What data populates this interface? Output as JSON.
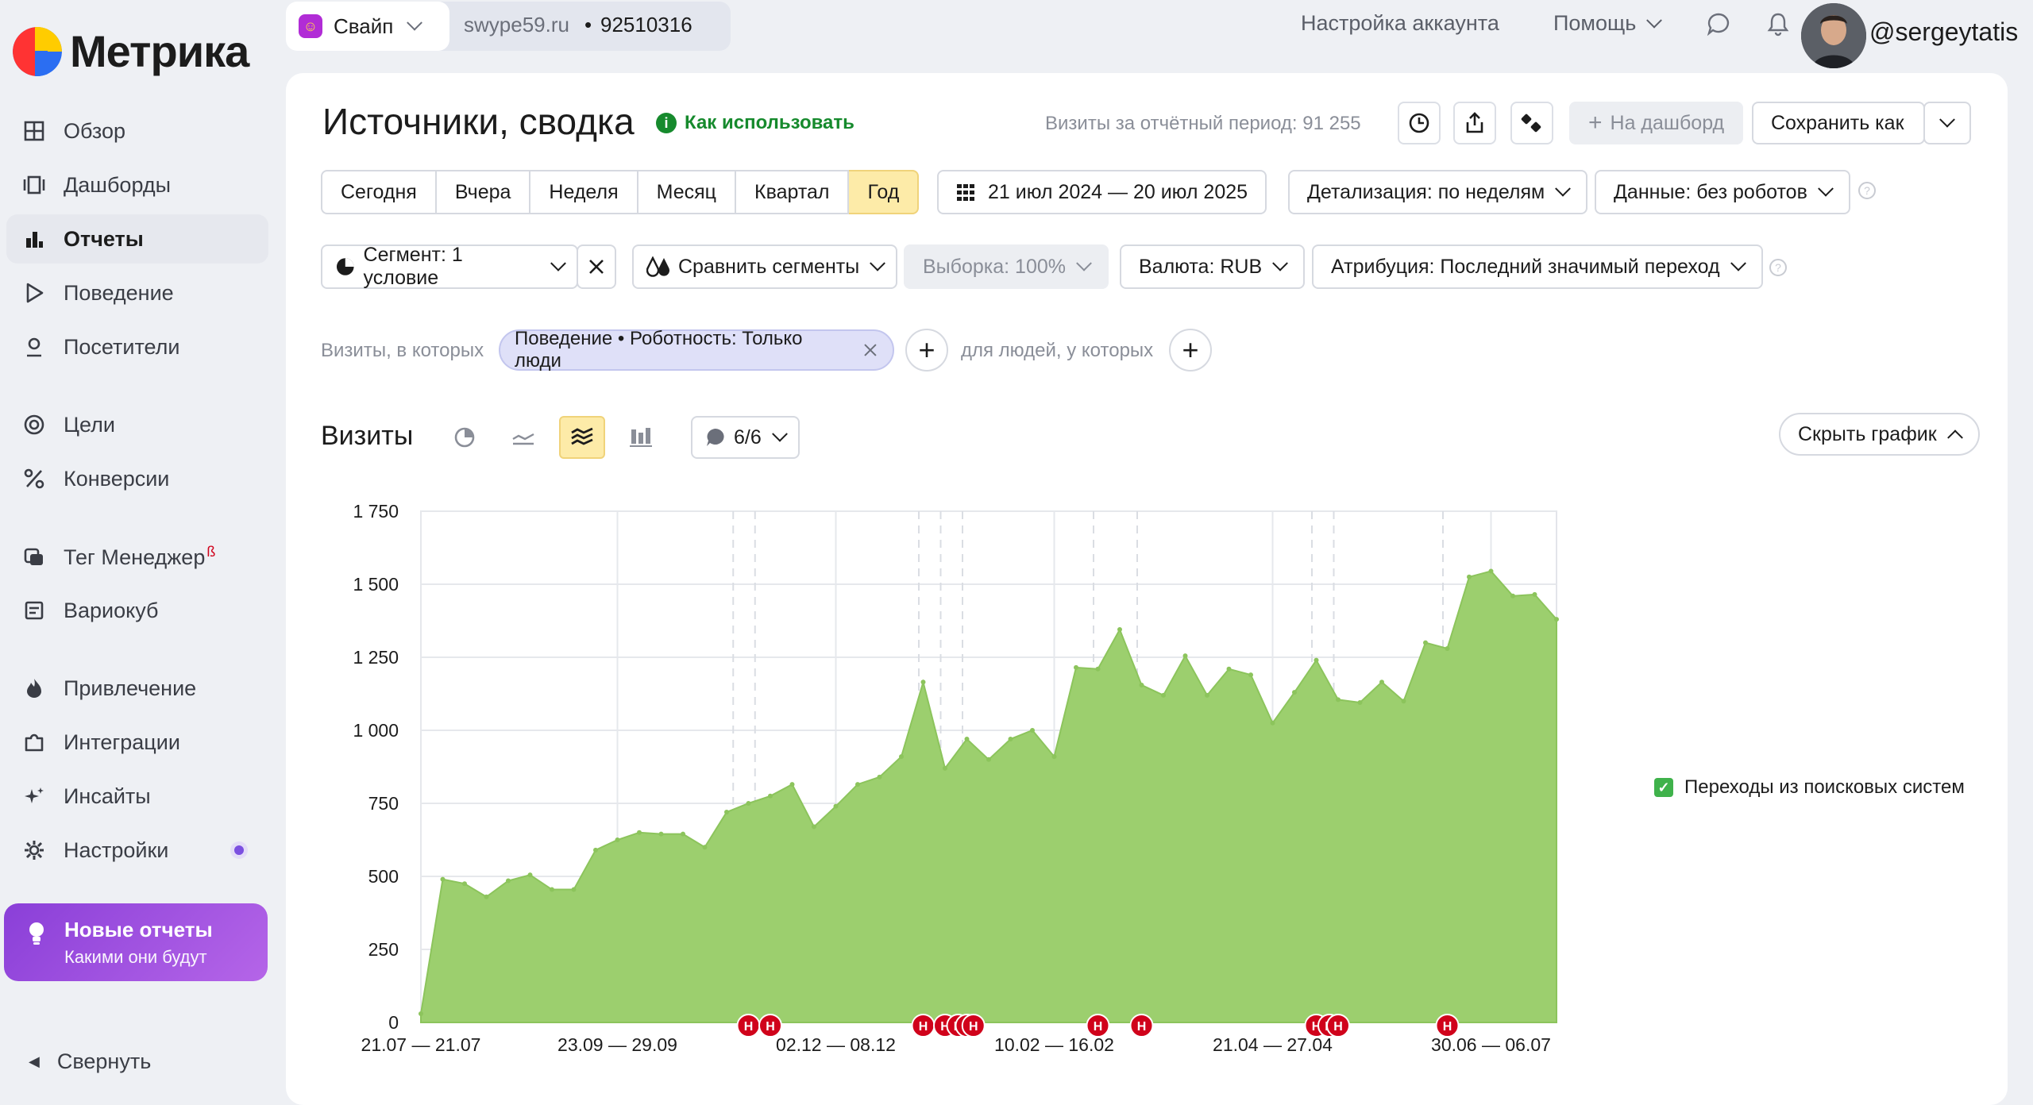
{
  "app": {
    "logo_text": "Метрика"
  },
  "sidebar": {
    "items": [
      {
        "label": "Обзор",
        "icon": "grid-icon"
      },
      {
        "label": "Дашборды",
        "icon": "dashboards-icon"
      },
      {
        "label": "Отчеты",
        "icon": "bar-chart-icon"
      },
      {
        "label": "Поведение",
        "icon": "play-icon"
      },
      {
        "label": "Посетители",
        "icon": "person-icon"
      },
      {
        "label": "Цели",
        "icon": "target-icon"
      },
      {
        "label": "Конверсии",
        "icon": "percent-icon"
      },
      {
        "label": "Тег Менеджер",
        "icon": "tag-manager-icon",
        "beta": "ß"
      },
      {
        "label": "Вариокуб",
        "icon": "variocube-icon"
      },
      {
        "label": "Привлечение",
        "icon": "fire-icon"
      },
      {
        "label": "Интеграции",
        "icon": "puzzle-icon"
      },
      {
        "label": "Инсайты",
        "icon": "sparkle-icon"
      },
      {
        "label": "Настройки",
        "icon": "gear-icon"
      }
    ],
    "promo": {
      "title": "Новые отчеты",
      "subtitle": "Какими они будут"
    },
    "collapse_label": "Свернуть"
  },
  "topbar": {
    "site_name": "Свайп",
    "site_domain": "swype59.ru",
    "separator": "•",
    "counter_id": "92510316",
    "account_settings": "Настройка аккаунта",
    "help": "Помощь",
    "username": "@sergeytatis"
  },
  "header": {
    "title": "Источники, сводка",
    "how_to": "Как использовать",
    "visits_total": "Визиты за отчётный период: 91 255",
    "to_dashboard": "На дашборд",
    "save_as": "Сохранить как"
  },
  "periods": {
    "items": [
      "Сегодня",
      "Вчера",
      "Неделя",
      "Месяц",
      "Квартал",
      "Год"
    ],
    "active": "Год",
    "date_range": "21 июл 2024 — 20 июл 2025",
    "detail": "Детализация: по неделям",
    "data": "Данные: без роботов"
  },
  "segments": {
    "segment": "Сегмент: 1 условие",
    "compare": "Сравнить сегменты",
    "sample": "Выборка: 100%",
    "currency": "Валюта: RUB",
    "attribution": "Атрибуция: Последний значимый переход"
  },
  "filters": {
    "visits_where": "Визиты, в которых",
    "chip": "Поведение • Роботность: Только люди",
    "people_where": "для людей, у которых"
  },
  "chart_panel": {
    "title": "Визиты",
    "series_count": "6/6",
    "hide_chart": "Скрыть график",
    "legend_label": "Переходы из поисковых систем"
  },
  "colors": {
    "accent_yellow": "#fdeba8",
    "area_green": "#9ccf6e",
    "legend_green": "#3fb24b",
    "marker_red": "#d0021b",
    "promo_purple": "#8a3fd8"
  },
  "chart_data": {
    "type": "area",
    "ylabel": "",
    "ylim": [
      0,
      1750
    ],
    "yticks": [
      "0",
      "250",
      "500",
      "750",
      "1 000",
      "1 250",
      "1 500",
      "1 750"
    ],
    "xtick_labels": [
      "21.07 — 21.07",
      "23.09 — 29.09",
      "02.12 — 08.12",
      "10.02 — 16.02",
      "21.04 — 27.04",
      "30.06 — 06.07"
    ],
    "series": [
      {
        "name": "Переходы из поисковых систем",
        "values": [
          30,
          490,
          475,
          430,
          485,
          505,
          455,
          455,
          590,
          625,
          650,
          645,
          645,
          600,
          720,
          750,
          775,
          815,
          670,
          740,
          815,
          840,
          910,
          1165,
          870,
          970,
          900,
          970,
          1000,
          910,
          1215,
          1210,
          1345,
          1155,
          1120,
          1255,
          1120,
          1210,
          1190,
          1025,
          1130,
          1240,
          1105,
          1095,
          1165,
          1100,
          1300,
          1280,
          1525,
          1545,
          1460,
          1465,
          1380
        ]
      }
    ],
    "annotation_marker": "Н",
    "annotation_positions": [
      15,
      16,
      23,
      24,
      24.6,
      25,
      25.3,
      31,
      33,
      41,
      41.6,
      42,
      47
    ]
  }
}
